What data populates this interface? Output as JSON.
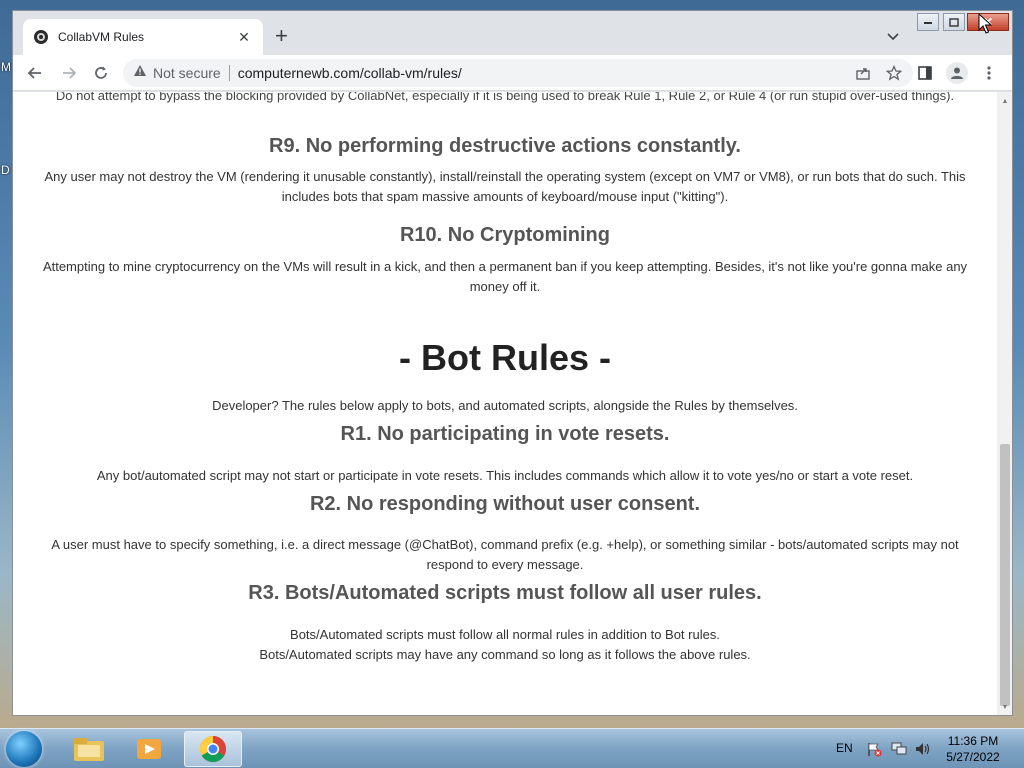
{
  "desktop": {
    "letters": [
      "M",
      "D"
    ]
  },
  "browser": {
    "tab": {
      "title": "CollabVM Rules"
    },
    "omnibox": {
      "security_label": "Not secure",
      "url": "computernewb.com/collab-vm/rules/"
    }
  },
  "page": {
    "cut_text": "Do not attempt to bypass the blocking provided by CollabNet, especially if it is being used to break Rule 1, Rule 2, or Rule 4 (or run stupid over-used things).",
    "rules": [
      {
        "heading": "R9. No performing destructive actions constantly.",
        "body": "Any user may not destroy the VM (rendering it unusable constantly), install/reinstall the operating system (except on VM7 or VM8), or run bots that do such. This includes bots that spam massive amounts of keyboard/mouse input (\"kitting\")."
      },
      {
        "heading": "R10. No Cryptomining",
        "body": "Attempting to mine cryptocurrency on the VMs will result in a kick, and then a permanent ban if you keep attempting. Besides, it's not like you're gonna make any money off it."
      }
    ],
    "bot_section": {
      "title": "- Bot Rules -",
      "intro": "Developer? The rules below apply to bots, and automated scripts, alongside the Rules by themselves.",
      "rules": [
        {
          "heading": "R1. No participating in vote resets.",
          "body": "Any bot/automated script may not start or participate in vote resets. This includes commands which allow it to vote yes/no or start a vote reset."
        },
        {
          "heading": "R2. No responding without user consent.",
          "body": "A user must have to specify something, i.e. a direct message (@ChatBot), command prefix (e.g. +help), or something similar - bots/automated scripts may not respond to every message."
        },
        {
          "heading": "R3. Bots/Automated scripts must follow all user rules.",
          "body_line1": "Bots/Automated scripts must follow all normal rules in addition to Bot rules.",
          "body_line2": "Bots/Automated scripts may have any command so long as it follows the above rules."
        }
      ]
    }
  },
  "taskbar": {
    "language": "EN",
    "time": "11:36 PM",
    "date": "5/27/2022"
  }
}
